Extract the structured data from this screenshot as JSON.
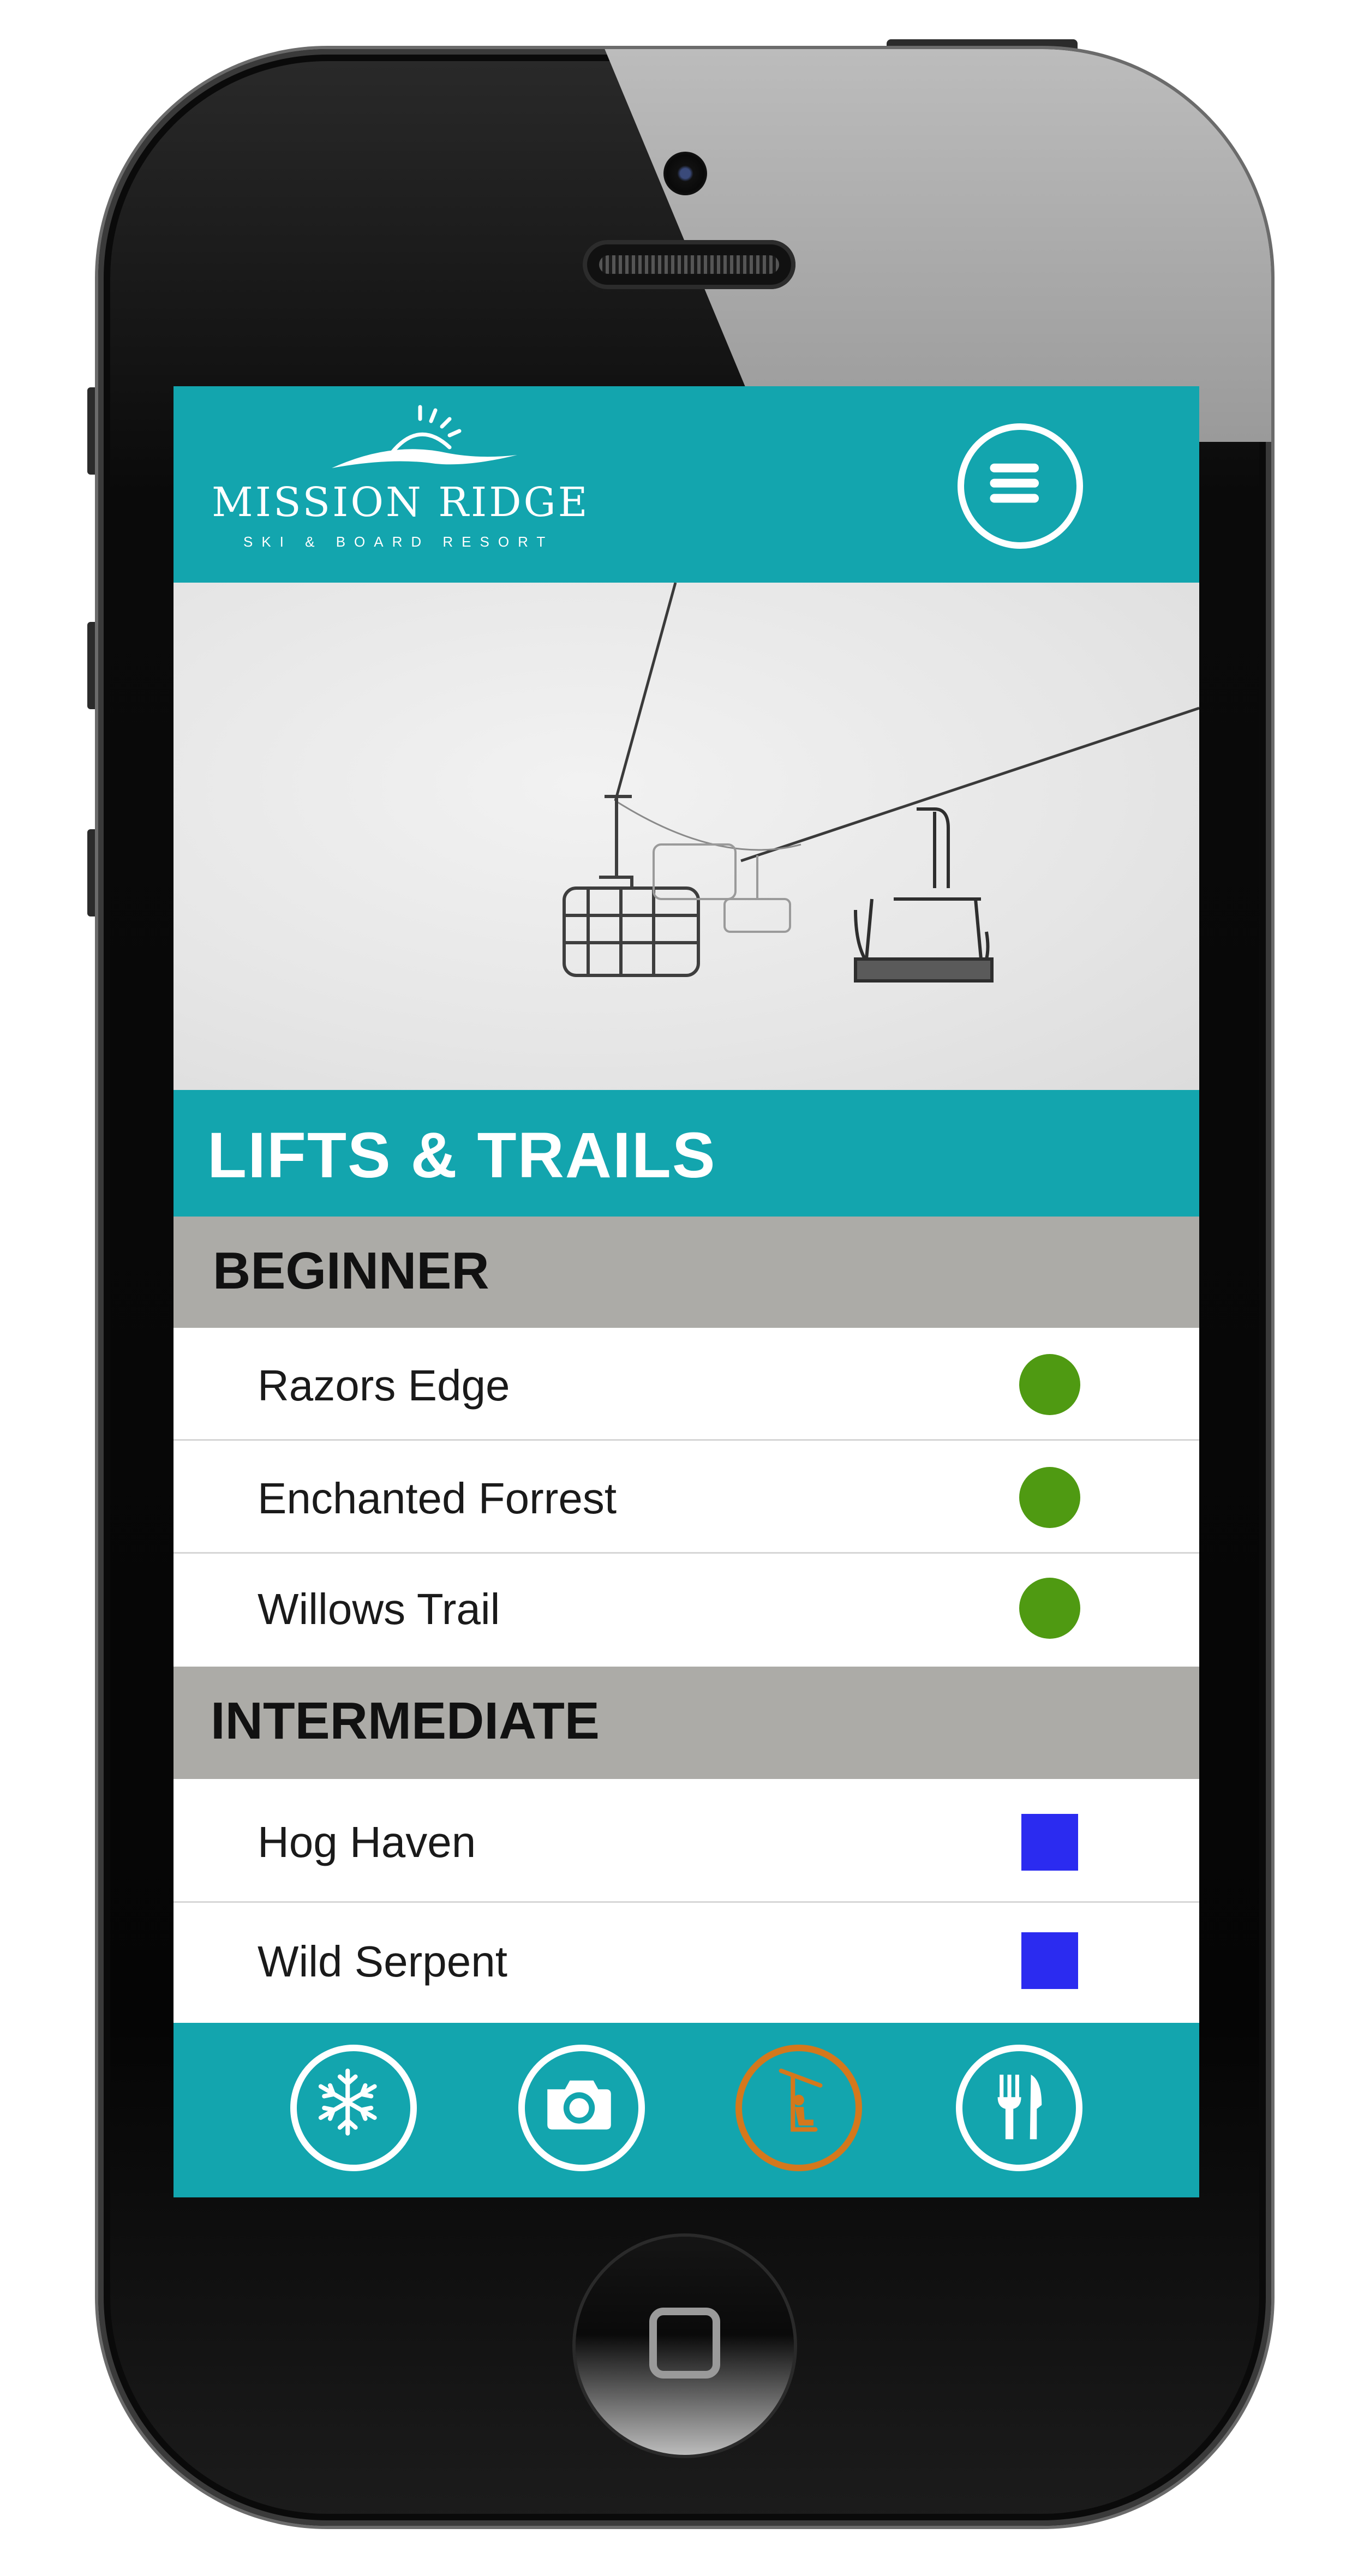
{
  "app": {
    "logo_name": "MISSION RIDGE",
    "logo_tagline": "SKI & BOARD RESORT"
  },
  "header": {
    "menu_icon": "hamburger-menu-icon"
  },
  "hero": {
    "image": "chairlift-in-fog-photo"
  },
  "page": {
    "title": "LIFTS & TRAILS"
  },
  "sections": [
    {
      "label": "BEGINNER",
      "symbol": "green-circle",
      "color": "#4f9a12",
      "trails": [
        {
          "name": "Razors Edge"
        },
        {
          "name": "Enchanted Forrest"
        },
        {
          "name": "Willows Trail"
        }
      ]
    },
    {
      "label": "INTERMEDIATE",
      "symbol": "blue-square",
      "color": "#2b2bf0",
      "trails": [
        {
          "name": "Hog Haven"
        },
        {
          "name": "Wild Serpent"
        }
      ]
    }
  ],
  "tabbar": {
    "tabs": [
      {
        "icon": "snowflake-icon",
        "active": false
      },
      {
        "icon": "camera-icon",
        "active": false
      },
      {
        "icon": "chairlift-icon",
        "active": true
      },
      {
        "icon": "fork-knife-icon",
        "active": false
      }
    ],
    "accent_color": "#13a5ae",
    "active_color": "#d4781c"
  }
}
